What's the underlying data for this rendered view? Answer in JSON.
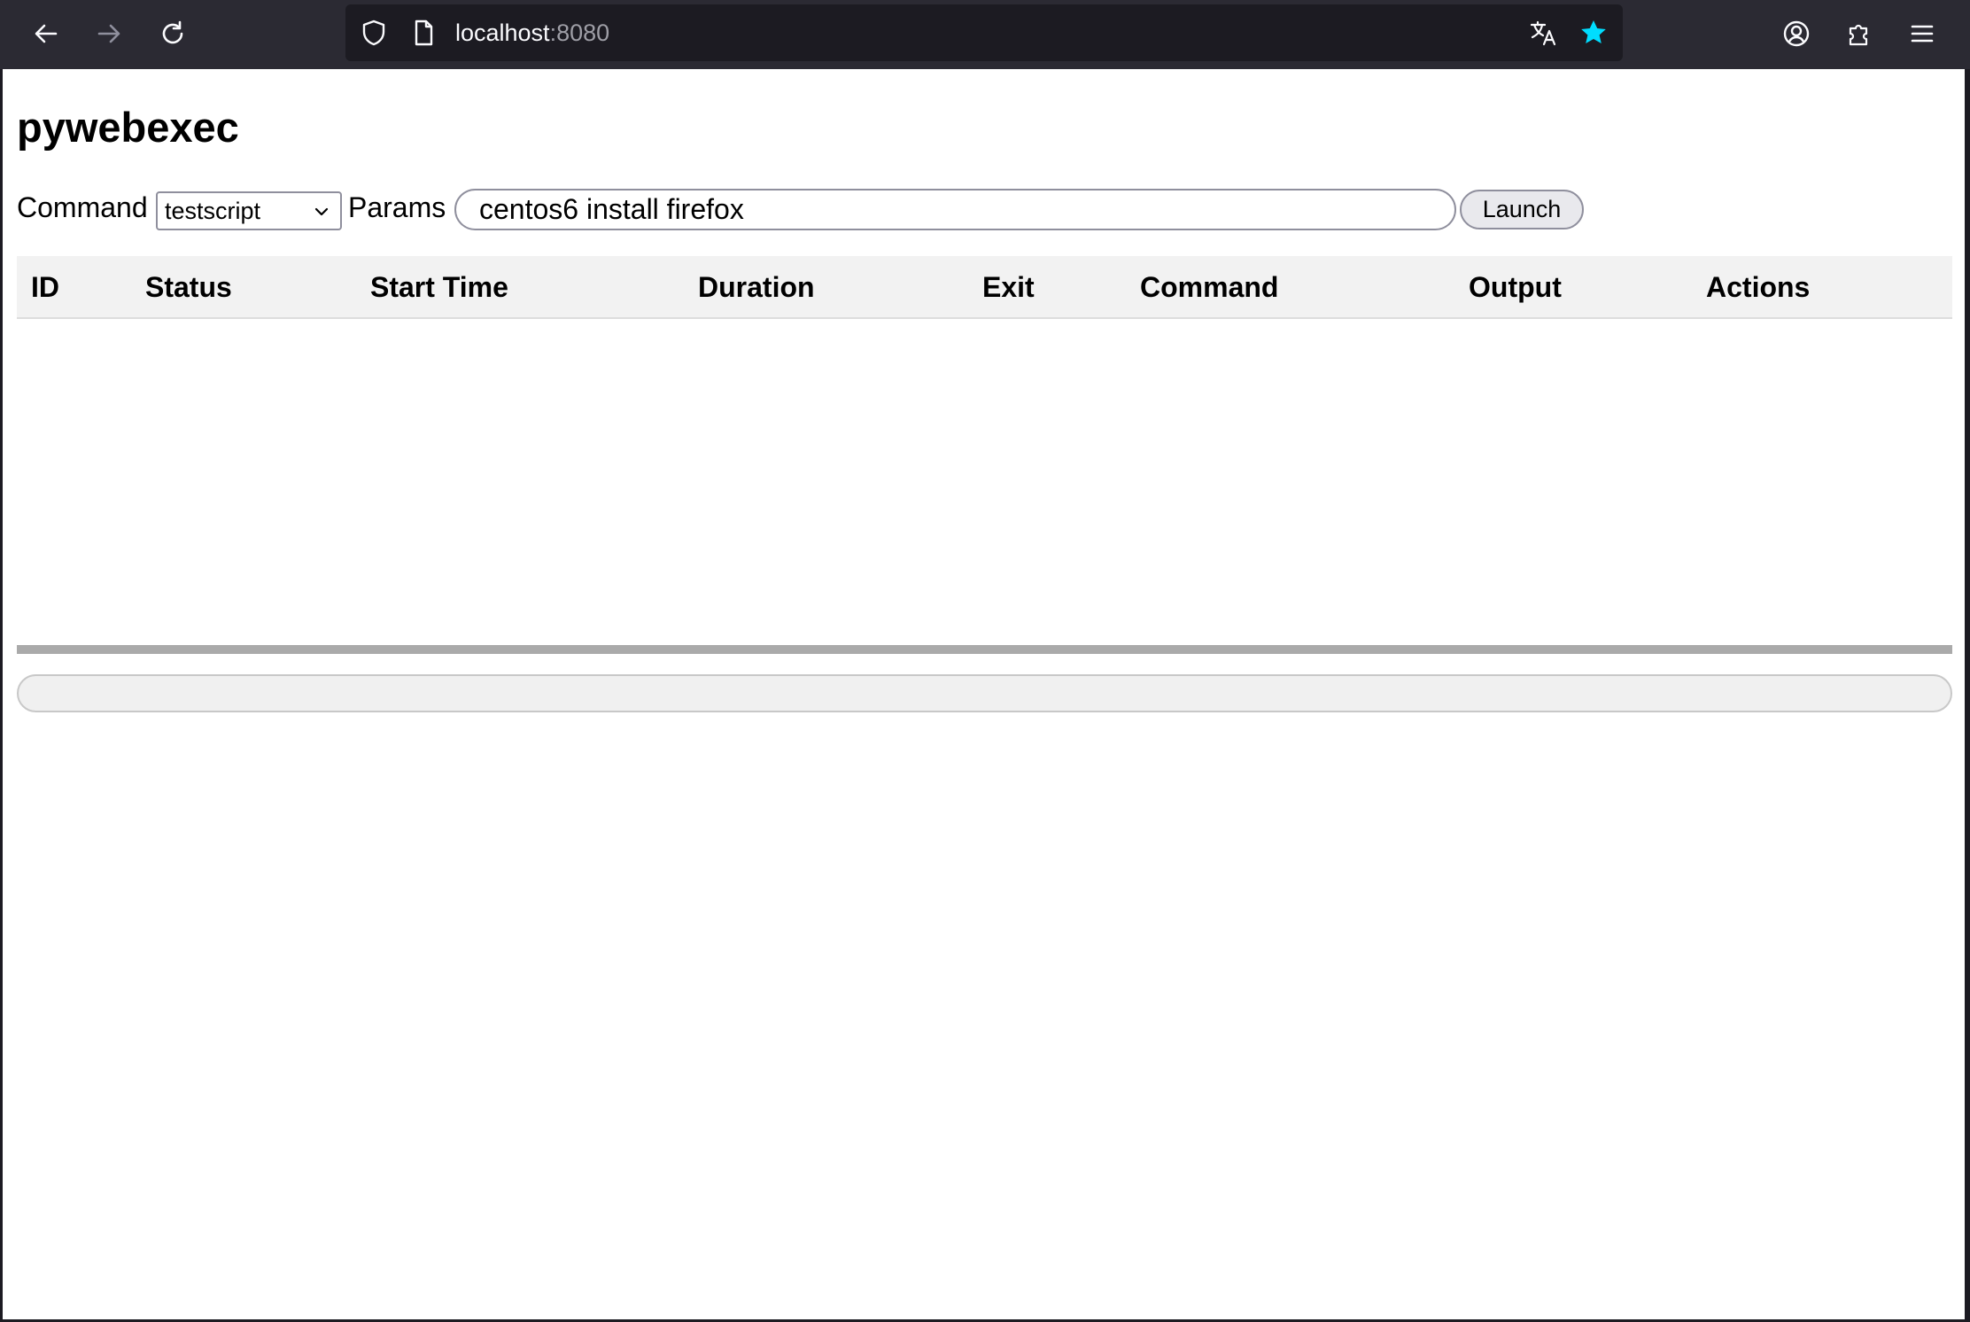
{
  "browser": {
    "url_host": "localhost",
    "url_port": ":8080",
    "colors": {
      "bookmark_star": "#00ddff"
    }
  },
  "page": {
    "title": "pywebexec",
    "command_label": "Command",
    "command_selected": "testscript",
    "params_label": "Params",
    "params_value": "centos6 install firefox",
    "launch_label": "Launch"
  },
  "table": {
    "headers": [
      "ID",
      "Status",
      "Start Time",
      "Duration",
      "Exit",
      "Command",
      "Output",
      "Actions"
    ],
    "rows": []
  },
  "output": {
    "text": ""
  }
}
